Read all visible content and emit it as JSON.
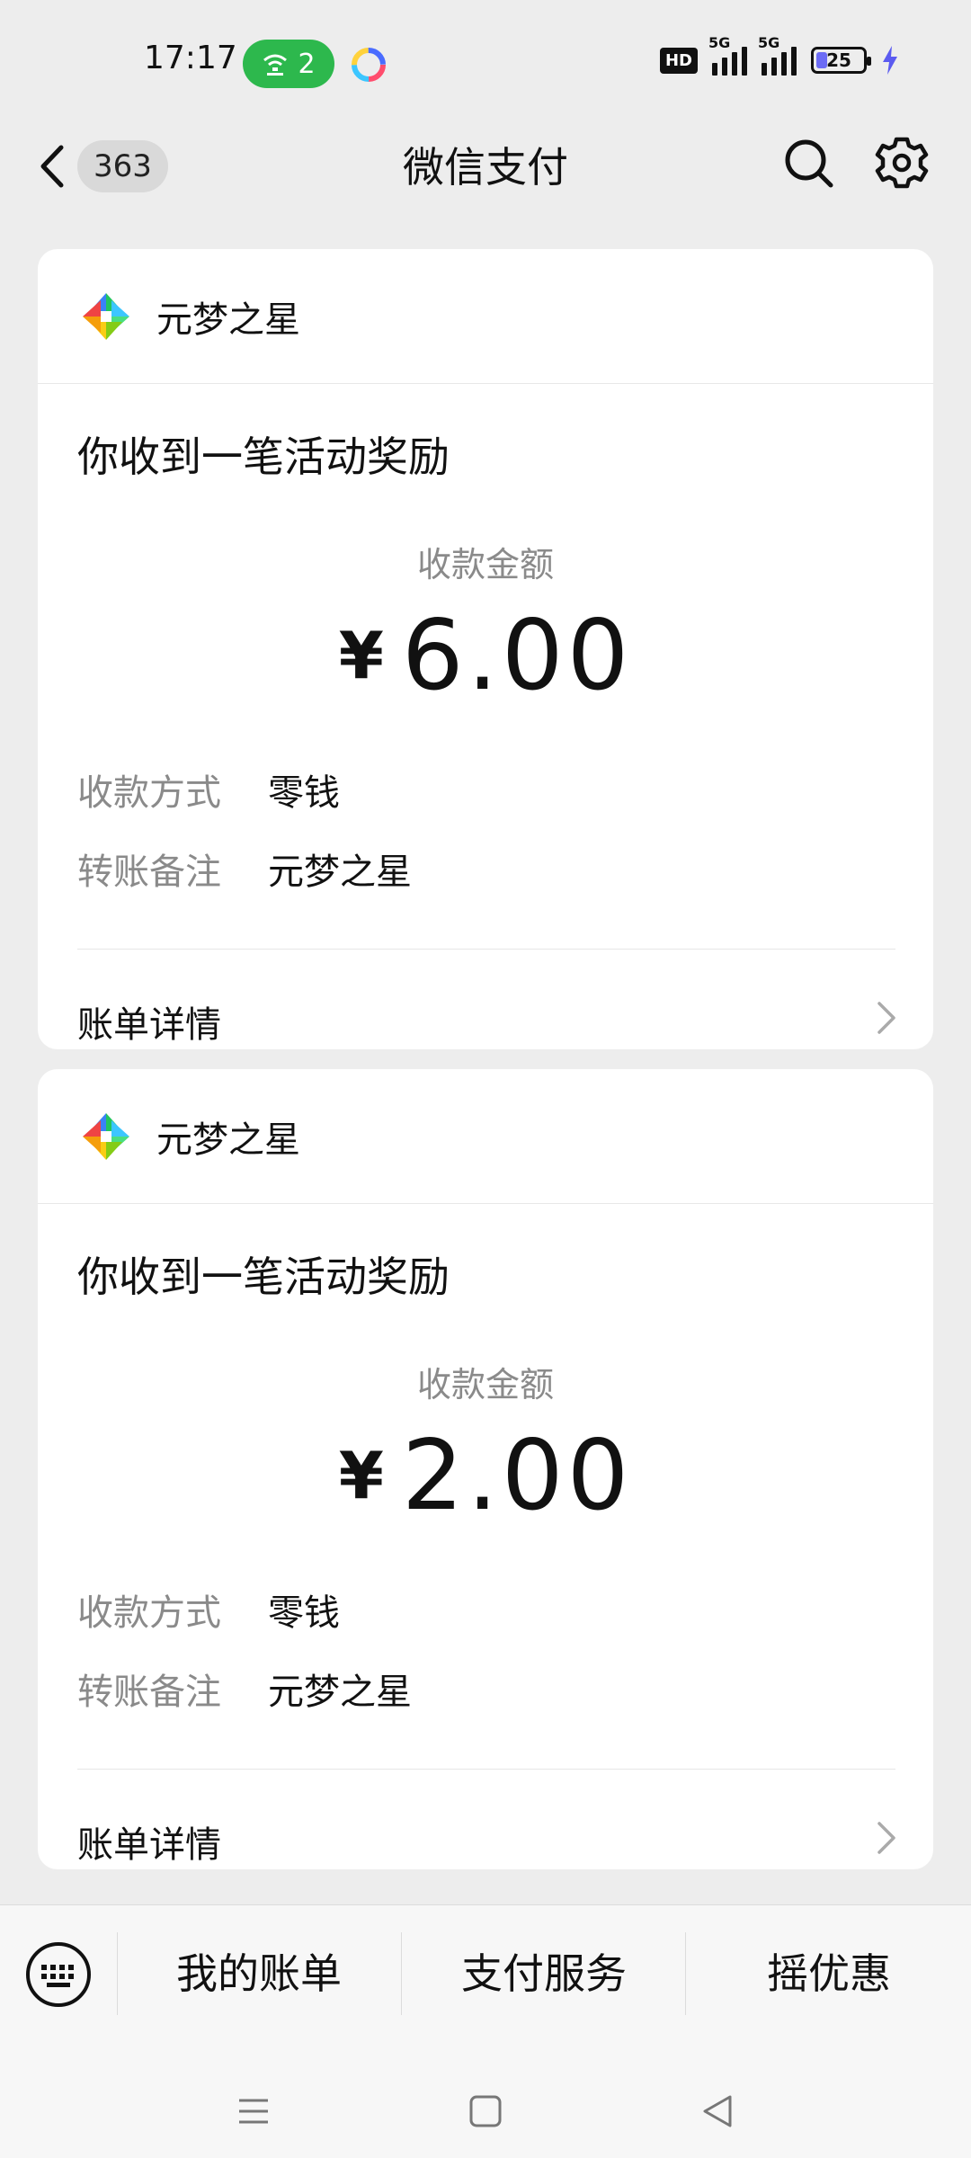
{
  "status_bar": {
    "time": "17:17",
    "wifi_count": "2",
    "signal_tag_1": "5G",
    "signal_tag_2": "5G",
    "hd_label": "HD",
    "battery_level": "25",
    "accent_green": "#2db84d"
  },
  "nav": {
    "back_count": "363",
    "title": "微信支付",
    "icons": [
      "chevron-left-icon",
      "search-icon",
      "gear-icon"
    ]
  },
  "cards": [
    {
      "merchant": "元梦之星",
      "title": "你收到一笔活动奖励",
      "amount_label": "收款金额",
      "currency": "¥",
      "amount": "6.00",
      "method_label": "收款方式",
      "method_value": "零钱",
      "note_label": "转账备注",
      "note_value": "元梦之星",
      "bill_link": "账单详情"
    },
    {
      "merchant": "元梦之星",
      "title": "你收到一笔活动奖励",
      "amount_label": "收款金额",
      "currency": "¥",
      "amount": "2.00",
      "method_label": "收款方式",
      "method_value": "零钱",
      "note_label": "转账备注",
      "note_value": "元梦之星",
      "bill_link": "账单详情"
    }
  ],
  "bottom_menu": {
    "items": [
      "我的账单",
      "支付服务",
      "摇优惠"
    ]
  }
}
